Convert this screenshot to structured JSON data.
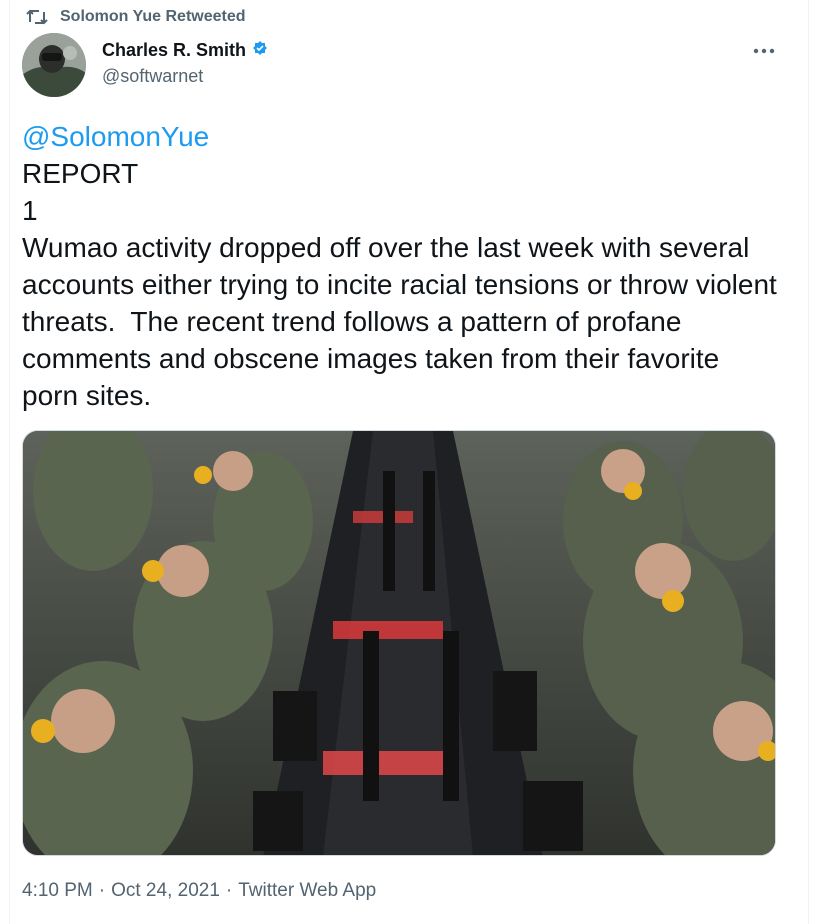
{
  "retweet": {
    "icon": "retweet-icon",
    "label": "Solomon Yue Retweeted"
  },
  "author": {
    "display_name": "Charles R. Smith",
    "handle": "@softwarnet",
    "verified_icon": "verified-badge-icon",
    "avatar_icon": "avatar"
  },
  "more_icon": "more-options-icon",
  "tweet": {
    "mention": "@SolomonYue",
    "line_report": "REPORT",
    "line_number": "1",
    "body": "Wumao activity dropped off over the last week with several accounts either trying to incite racial tensions or throw violent threats.  The recent trend follows a pattern of profane comments and obscene images taken from their favorite porn sites."
  },
  "media": {
    "kind": "photo"
  },
  "meta": {
    "time": "4:10 PM",
    "separator": "·",
    "date": "Oct 24, 2021",
    "source": "Twitter Web App"
  },
  "colors": {
    "accent": "#1d9bf0",
    "secondary_text": "#536471",
    "primary_text": "#0f1419"
  }
}
